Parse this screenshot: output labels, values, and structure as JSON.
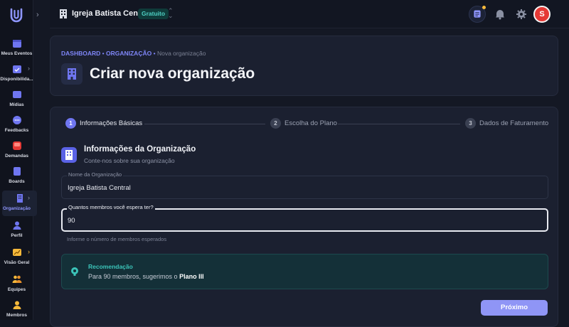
{
  "sidebar": {
    "items": [
      {
        "label": "Meus Eventos",
        "icon": "calendar-icon",
        "color": "#6f76f0"
      },
      {
        "label": "Disponibilida...",
        "icon": "calendar-check-icon",
        "color": "#6f76f0"
      },
      {
        "label": "Mídias",
        "icon": "media-icon",
        "color": "#6f76f0"
      },
      {
        "label": "Feedbacks",
        "icon": "chat-bubble-icon",
        "color": "#6f76f0"
      },
      {
        "label": "Demandas",
        "icon": "inbox-icon",
        "color": "#e53935"
      },
      {
        "label": "Boards",
        "icon": "board-icon",
        "color": "#6f76f0"
      },
      {
        "label": "Organização",
        "icon": "building-icon",
        "color": "#6f76f0"
      },
      {
        "label": "Perfil",
        "icon": "user-icon",
        "color": "#6f76f0"
      },
      {
        "label": "Visão Geral",
        "icon": "chart-icon",
        "color": "#f6b93b"
      },
      {
        "label": "Equipes",
        "icon": "team-icon",
        "color": "#f6b93b"
      },
      {
        "label": "Membros",
        "icon": "member-icon",
        "color": "#f6b93b"
      }
    ]
  },
  "topbar": {
    "org_name": "Igreja Batista Central",
    "plan_badge": "Gratuito",
    "avatar_initial": "S"
  },
  "header": {
    "breadcrumb": {
      "root": "DASHBOARD",
      "parent": "ORGANIZAÇÃO",
      "separator": "•",
      "current": "Nova organização"
    },
    "title": "Criar nova organização"
  },
  "stepper": {
    "steps": [
      {
        "number": "1",
        "label": "Informações Básicas"
      },
      {
        "number": "2",
        "label": "Escolha do Plano"
      },
      {
        "number": "3",
        "label": "Dados de Faturamento"
      }
    ]
  },
  "form": {
    "section_title": "Informações da Organização",
    "section_subtitle": "Conte-nos sobre sua organização",
    "org_name_label": "Nome da Organização",
    "org_name_value": "Igreja Batista Central",
    "members_label": "Quantos membros você espera ter?",
    "members_value": "90",
    "members_helper": "Informe o número de membros esperados"
  },
  "recommendation": {
    "title": "Recomendação",
    "text": "Para 90 membros, sugerimos o ",
    "plan": "Plano III"
  },
  "actions": {
    "next_label": "Próximo"
  },
  "colors": {
    "accent": "#6f76f0",
    "teal": "#3bc4b9",
    "danger": "#e53935"
  }
}
